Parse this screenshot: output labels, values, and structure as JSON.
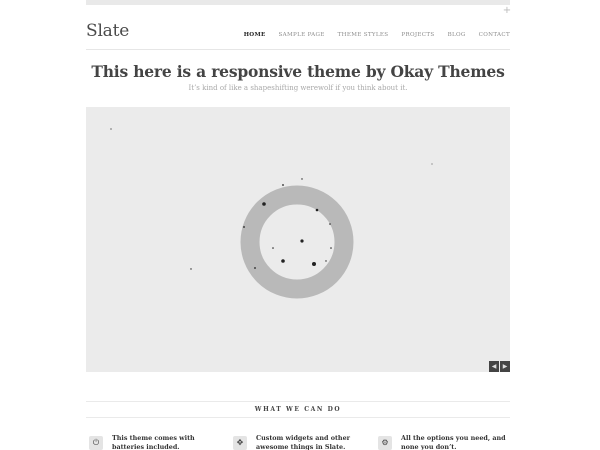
{
  "header": {
    "logo": "Slate",
    "toggle_icon": "plus-icon",
    "nav": [
      "HOME",
      "SAMPLE PAGE",
      "THEME STYLES",
      "PROJECTS",
      "BLOG",
      "CONTACT"
    ],
    "active_nav": "HOME"
  },
  "hero": {
    "title": "This here is a responsive theme by Okay Themes",
    "subtitle": "It’s kind of like a shapeshifting werewolf if you think about it."
  },
  "slider": {
    "prev_icon": "chevron-left-icon",
    "next_icon": "chevron-right-icon",
    "ring_color": "#b9b9b9",
    "background_color": "#ebebeb"
  },
  "features": {
    "heading": "WHAT WE CAN DO",
    "items": [
      {
        "icon": "power-icon",
        "text": "This theme comes with batteries included."
      },
      {
        "icon": "move-arrows-icon",
        "text": "Custom widgets and other awesome things in Slate."
      },
      {
        "icon": "gear-icon",
        "text": "All the options you need, and none you don’t."
      }
    ]
  }
}
